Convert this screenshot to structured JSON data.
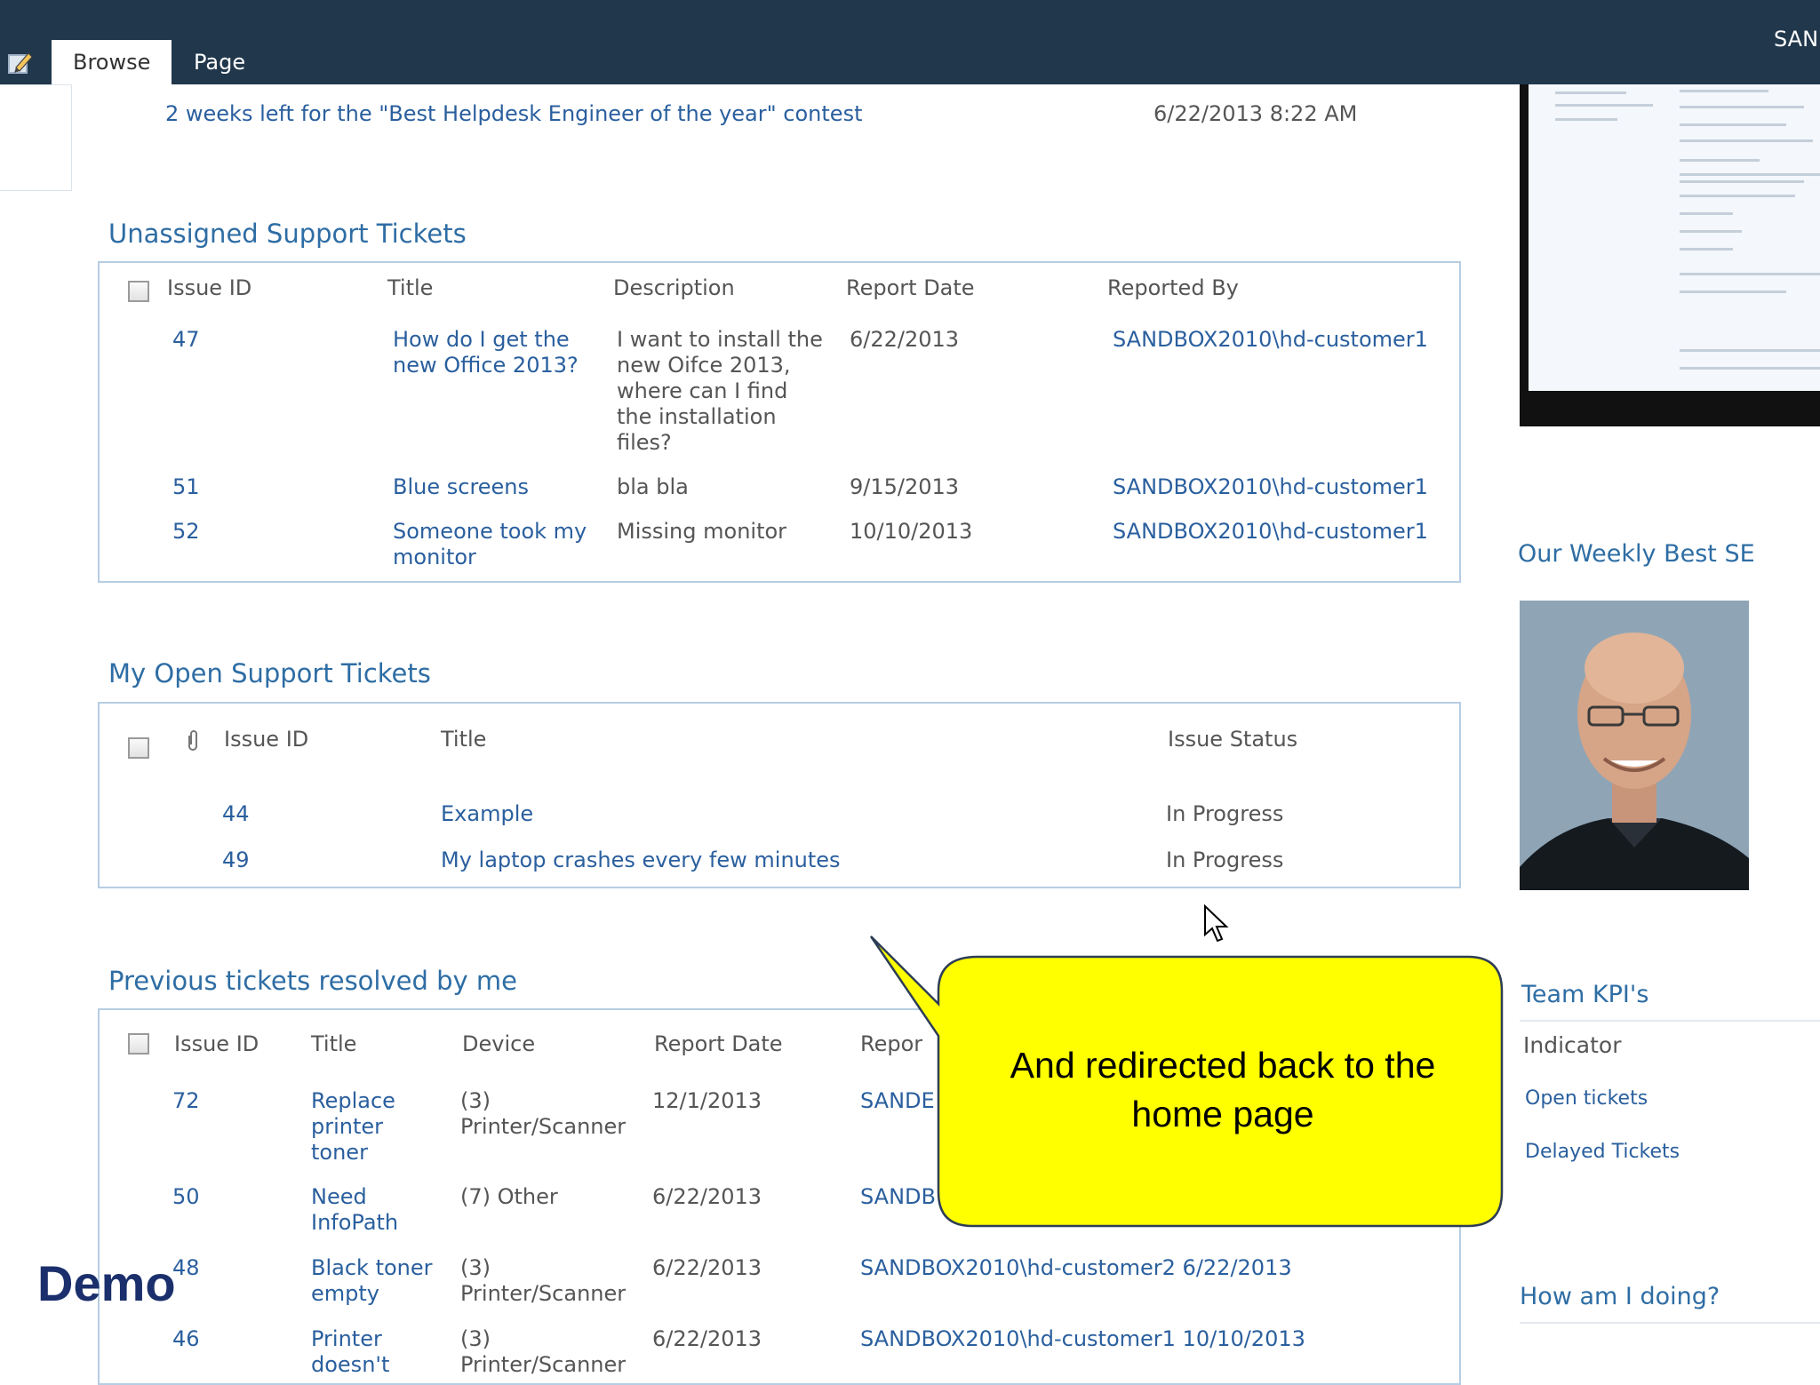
{
  "ribbon": {
    "tabs": [
      {
        "label": "Browse"
      },
      {
        "label": "Page"
      }
    ],
    "user_label": "SAN"
  },
  "announcement": {
    "title": "2 weeks left for the \"Best Helpdesk Engineer of the year\" contest",
    "date": "6/22/2013 8:22 AM"
  },
  "unassigned": {
    "title": "Unassigned Support Tickets",
    "columns": [
      "Issue ID",
      "Title",
      "Description",
      "Report Date",
      "Reported By"
    ],
    "rows": [
      {
        "id": "47",
        "title_lines": [
          "How do I get the",
          "new Office 2013?"
        ],
        "desc_lines": [
          "I want to install the",
          "new Oifce 2013,",
          "where can I find",
          "the installation",
          "files?"
        ],
        "date": "6/22/2013",
        "by": "SANDBOX2010\\hd-customer1"
      },
      {
        "id": "51",
        "title_lines": [
          "Blue screens"
        ],
        "desc_lines": [
          "bla bla"
        ],
        "date": "9/15/2013",
        "by": "SANDBOX2010\\hd-customer1"
      },
      {
        "id": "52",
        "title_lines": [
          "Someone took my",
          "monitor"
        ],
        "desc_lines": [
          "Missing monitor"
        ],
        "date": "10/10/2013",
        "by": "SANDBOX2010\\hd-customer1"
      }
    ]
  },
  "open": {
    "title": "My Open Support Tickets",
    "columns": [
      "Issue ID",
      "Title",
      "Issue Status"
    ],
    "rows": [
      {
        "id": "44",
        "title": "Example",
        "status": "In Progress"
      },
      {
        "id": "49",
        "title": "My laptop crashes every few minutes",
        "status": "In Progress"
      }
    ]
  },
  "resolved": {
    "title": "Previous tickets resolved by me",
    "columns": [
      "Issue ID",
      "Title",
      "Device",
      "Report Date",
      "Repor"
    ],
    "rows": [
      {
        "id": "72",
        "title_lines": [
          "Replace",
          "printer",
          "toner"
        ],
        "device_lines": [
          "(3)",
          "Printer/Scanner"
        ],
        "date": "12/1/2013",
        "reporter": "SANDE"
      },
      {
        "id": "50",
        "title_lines": [
          "Need",
          "InfoPath"
        ],
        "device_lines": [
          "(7) Other"
        ],
        "date": "6/22/2013",
        "reporter": "SANDB"
      },
      {
        "id": "48",
        "title_lines": [
          "Black toner",
          "empty"
        ],
        "device_lines": [
          "(3)",
          "Printer/Scanner"
        ],
        "date": "6/22/2013",
        "reporter": "SANDBOX2010\\hd-customer2 6/22/2013"
      },
      {
        "id": "46",
        "title_lines": [
          "Printer",
          "doesn't"
        ],
        "device_lines": [
          "(3)",
          "Printer/Scanner"
        ],
        "date": "6/22/2013",
        "reporter": "SANDBOX2010\\hd-customer1 10/10/2013"
      }
    ]
  },
  "sidebar": {
    "best_se_title": "Our Weekly Best SE",
    "kpi_title": "Team KPI's",
    "kpi_header": "Indicator",
    "kpi_items": [
      "Open tickets",
      "Delayed Tickets"
    ],
    "how_title": "How am I doing?"
  },
  "callout": {
    "lines": [
      "And redirected back to the",
      "home page"
    ],
    "fill": "#ffff00"
  },
  "overlay_label": "Demo"
}
